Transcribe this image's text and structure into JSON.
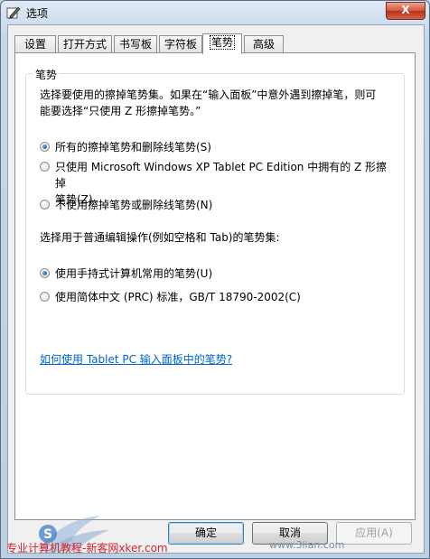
{
  "window": {
    "title": "选项",
    "close_label": "X"
  },
  "tabs": [
    {
      "label": "设置"
    },
    {
      "label": "打开方式"
    },
    {
      "label": "书写板"
    },
    {
      "label": "字符板"
    },
    {
      "label": "笔势",
      "active": true
    },
    {
      "label": "高级"
    }
  ],
  "group": {
    "title": "笔势",
    "description_line1": "选择要使用的擦掉笔势集。如果在“输入面板”中意外遇到擦掉笔，则可",
    "description_line2": "能要选择“只使用 Z 形擦掉笔势。”",
    "erase_options": [
      {
        "label": "所有的擦掉笔势和删除线笔势(S)",
        "selected": true
      },
      {
        "label_line1": "只使用 Microsoft Windows XP Tablet PC Edition 中拥有的 Z 形擦掉",
        "label_line2": "笔势(Z)",
        "selected": false
      },
      {
        "label": "不使用擦掉笔势或删除线笔势(N)",
        "selected": false
      }
    ],
    "edit_prompt": "选择用于普通编辑操作(例如空格和 Tab)的笔势集:",
    "edit_options": [
      {
        "label": "使用手持式计算机常用的笔势(U)",
        "selected": true
      },
      {
        "label": "使用简体中文 (PRC) 标准，GB/T 18790-2002(C)",
        "selected": false
      }
    ],
    "help_link": "如何使用 Tablet PC 输入面板中的笔势?"
  },
  "buttons": {
    "ok": "确定",
    "cancel": "取消",
    "apply": "应用(A)"
  },
  "watermark": {
    "caption": "专业计算机教程-新客网xker.com",
    "logo_text": "S",
    "site": "www.3lian.com"
  },
  "colors": {
    "accent": "#0066cc",
    "close_button": "#c94a32",
    "watermark_red": "#d2232a"
  }
}
